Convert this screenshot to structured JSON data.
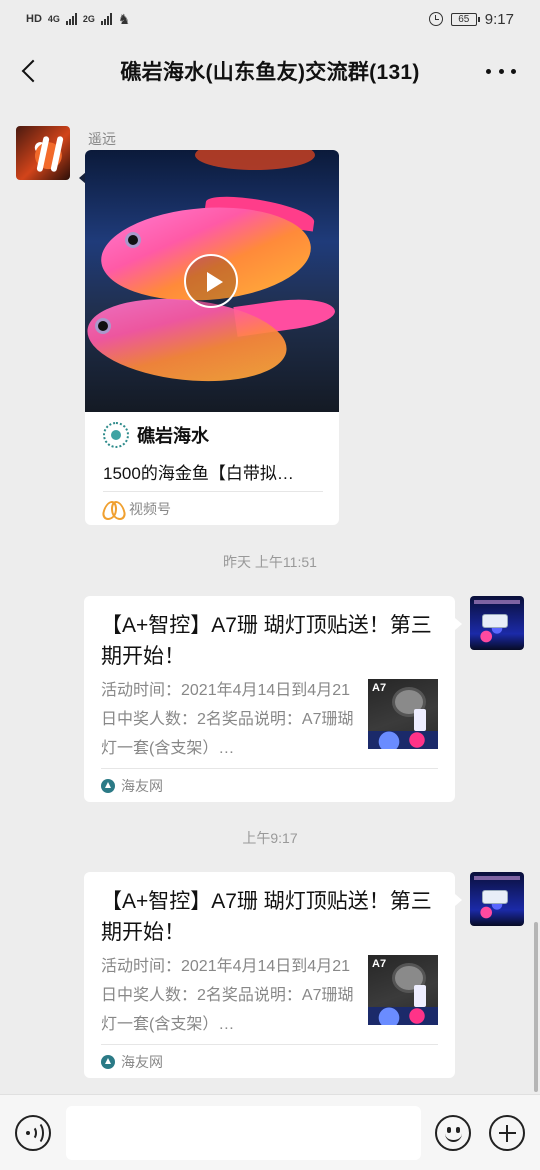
{
  "status_bar": {
    "network_left": "HD",
    "sim1": "4G",
    "sim2": "2G",
    "battery": "65",
    "time": "9:17"
  },
  "header": {
    "title": "礁岩海水(山东鱼友)交流群(131)",
    "back_icon": "chevron-left-icon",
    "more_icon": "more-horizontal-icon"
  },
  "messages": [
    {
      "sender": "遥远",
      "type": "video",
      "channel_name": "礁岩海水",
      "description": "1500的海金鱼【白带拟…",
      "source": "视频号"
    },
    {
      "timestamp": "昨天 上午11:51",
      "type": "link",
      "title": "【A+智控】A7珊 瑚灯顶贴送！第三期开始！",
      "description": "活动时间：2021年4月14日到4月21日中奖人数：2名奖品说明：A7珊瑚灯一套(含支架）…",
      "thumb_label": "A7",
      "source": "海友网"
    },
    {
      "timestamp": "上午9:17",
      "type": "link",
      "title": "【A+智控】A7珊 瑚灯顶贴送！第三期开始！",
      "description": "活动时间：2021年4月14日到4月21日中奖人数：2名奖品说明：A7珊瑚灯一套(含支架）…",
      "thumb_label": "A7",
      "source": "海友网"
    }
  ],
  "input_bar": {
    "voice_icon": "voice-icon",
    "emoji_icon": "emoji-icon",
    "plus_icon": "plus-icon"
  }
}
